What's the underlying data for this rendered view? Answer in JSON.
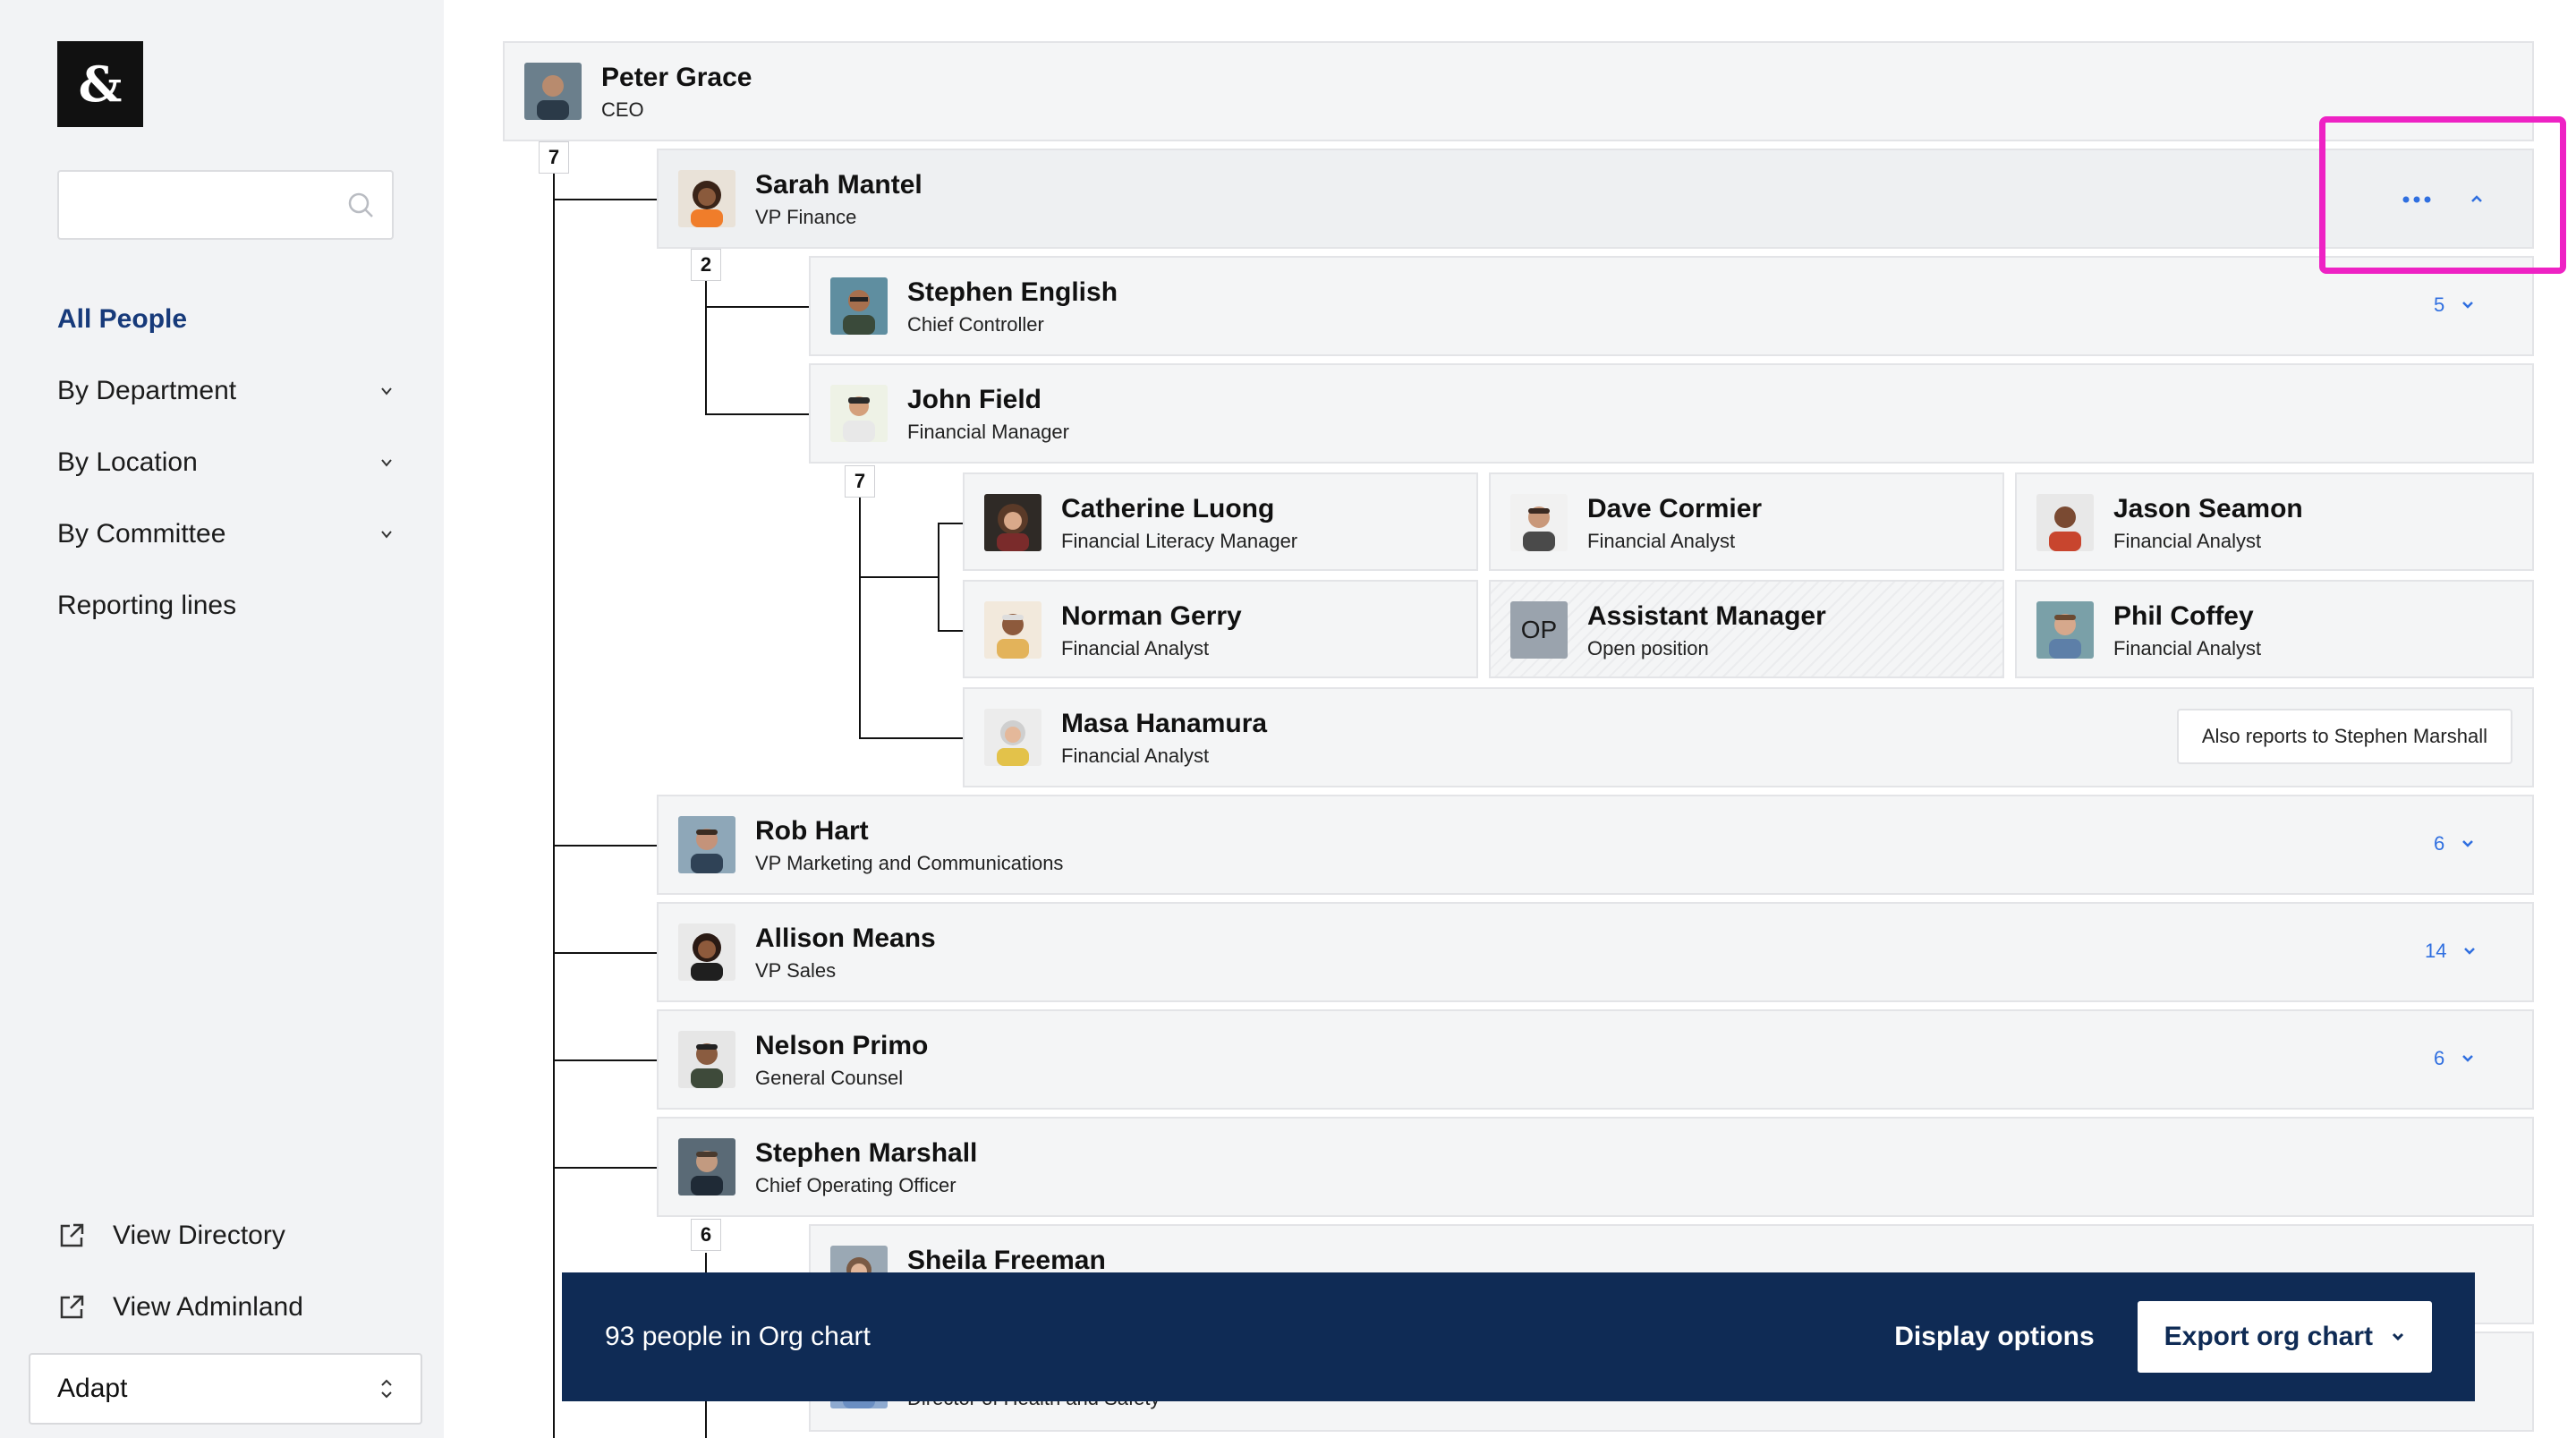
{
  "sidebar": {
    "logo_text": "&",
    "search": {
      "placeholder": "",
      "value": ""
    },
    "nav": [
      {
        "label": "All People",
        "active": true
      },
      {
        "label": "By Department"
      },
      {
        "label": "By Location"
      },
      {
        "label": "By Committee"
      },
      {
        "label": "Reporting lines"
      }
    ],
    "footer_links": [
      {
        "label": "View Directory"
      },
      {
        "label": "View Adminland"
      }
    ],
    "company_select": {
      "value": "Adapt"
    }
  },
  "orgchart": {
    "root": {
      "name": "Peter Grace",
      "title": "CEO",
      "reports_badge": "7"
    },
    "sarah": {
      "name": "Sarah Mantel",
      "title": "VP Finance",
      "reports_badge": "2",
      "menu_icon": "more-horizontal",
      "toggle_icon": "chevron-up"
    },
    "stephen_english": {
      "name": "Stephen English",
      "title": "Chief Controller",
      "count": "5"
    },
    "john": {
      "name": "John Field",
      "title": "Financial Manager",
      "reports_badge": "7"
    },
    "john_reports": [
      {
        "name": "Catherine Luong",
        "title": "Financial Literacy Manager"
      },
      {
        "name": "Dave Cormier",
        "title": "Financial Analyst"
      },
      {
        "name": "Jason Seamon",
        "title": "Financial Analyst"
      },
      {
        "name": "Norman Gerry",
        "title": "Financial Analyst"
      },
      {
        "name": "Assistant Manager",
        "title": "Open position",
        "initials": "OP"
      },
      {
        "name": "Phil Coffey",
        "title": "Financial Analyst"
      }
    ],
    "masa": {
      "name": "Masa Hanamura",
      "title": "Financial Analyst",
      "also_reports": "Also reports to Stephen Marshall"
    },
    "rob": {
      "name": "Rob Hart",
      "title": "VP Marketing and Communications",
      "count": "6"
    },
    "allison": {
      "name": "Allison Means",
      "title": "VP Sales",
      "count": "14"
    },
    "nelson": {
      "name": "Nelson Primo",
      "title": "General Counsel",
      "count": "6"
    },
    "stephen_marshall": {
      "name": "Stephen Marshall",
      "title": "Chief Operating Officer",
      "reports_badge": "6"
    },
    "sheila": {
      "name": "Sheila Freeman",
      "title": ""
    },
    "partial": {
      "name": "",
      "title": "Director of Health and Safety"
    }
  },
  "bottombar": {
    "summary": "93 people in Org chart",
    "display_options": "Display options",
    "export": "Export org chart"
  },
  "colors": {
    "accent": "#2f6fe0",
    "navy": "#0f2b55",
    "highlight": "#ee22c4"
  }
}
